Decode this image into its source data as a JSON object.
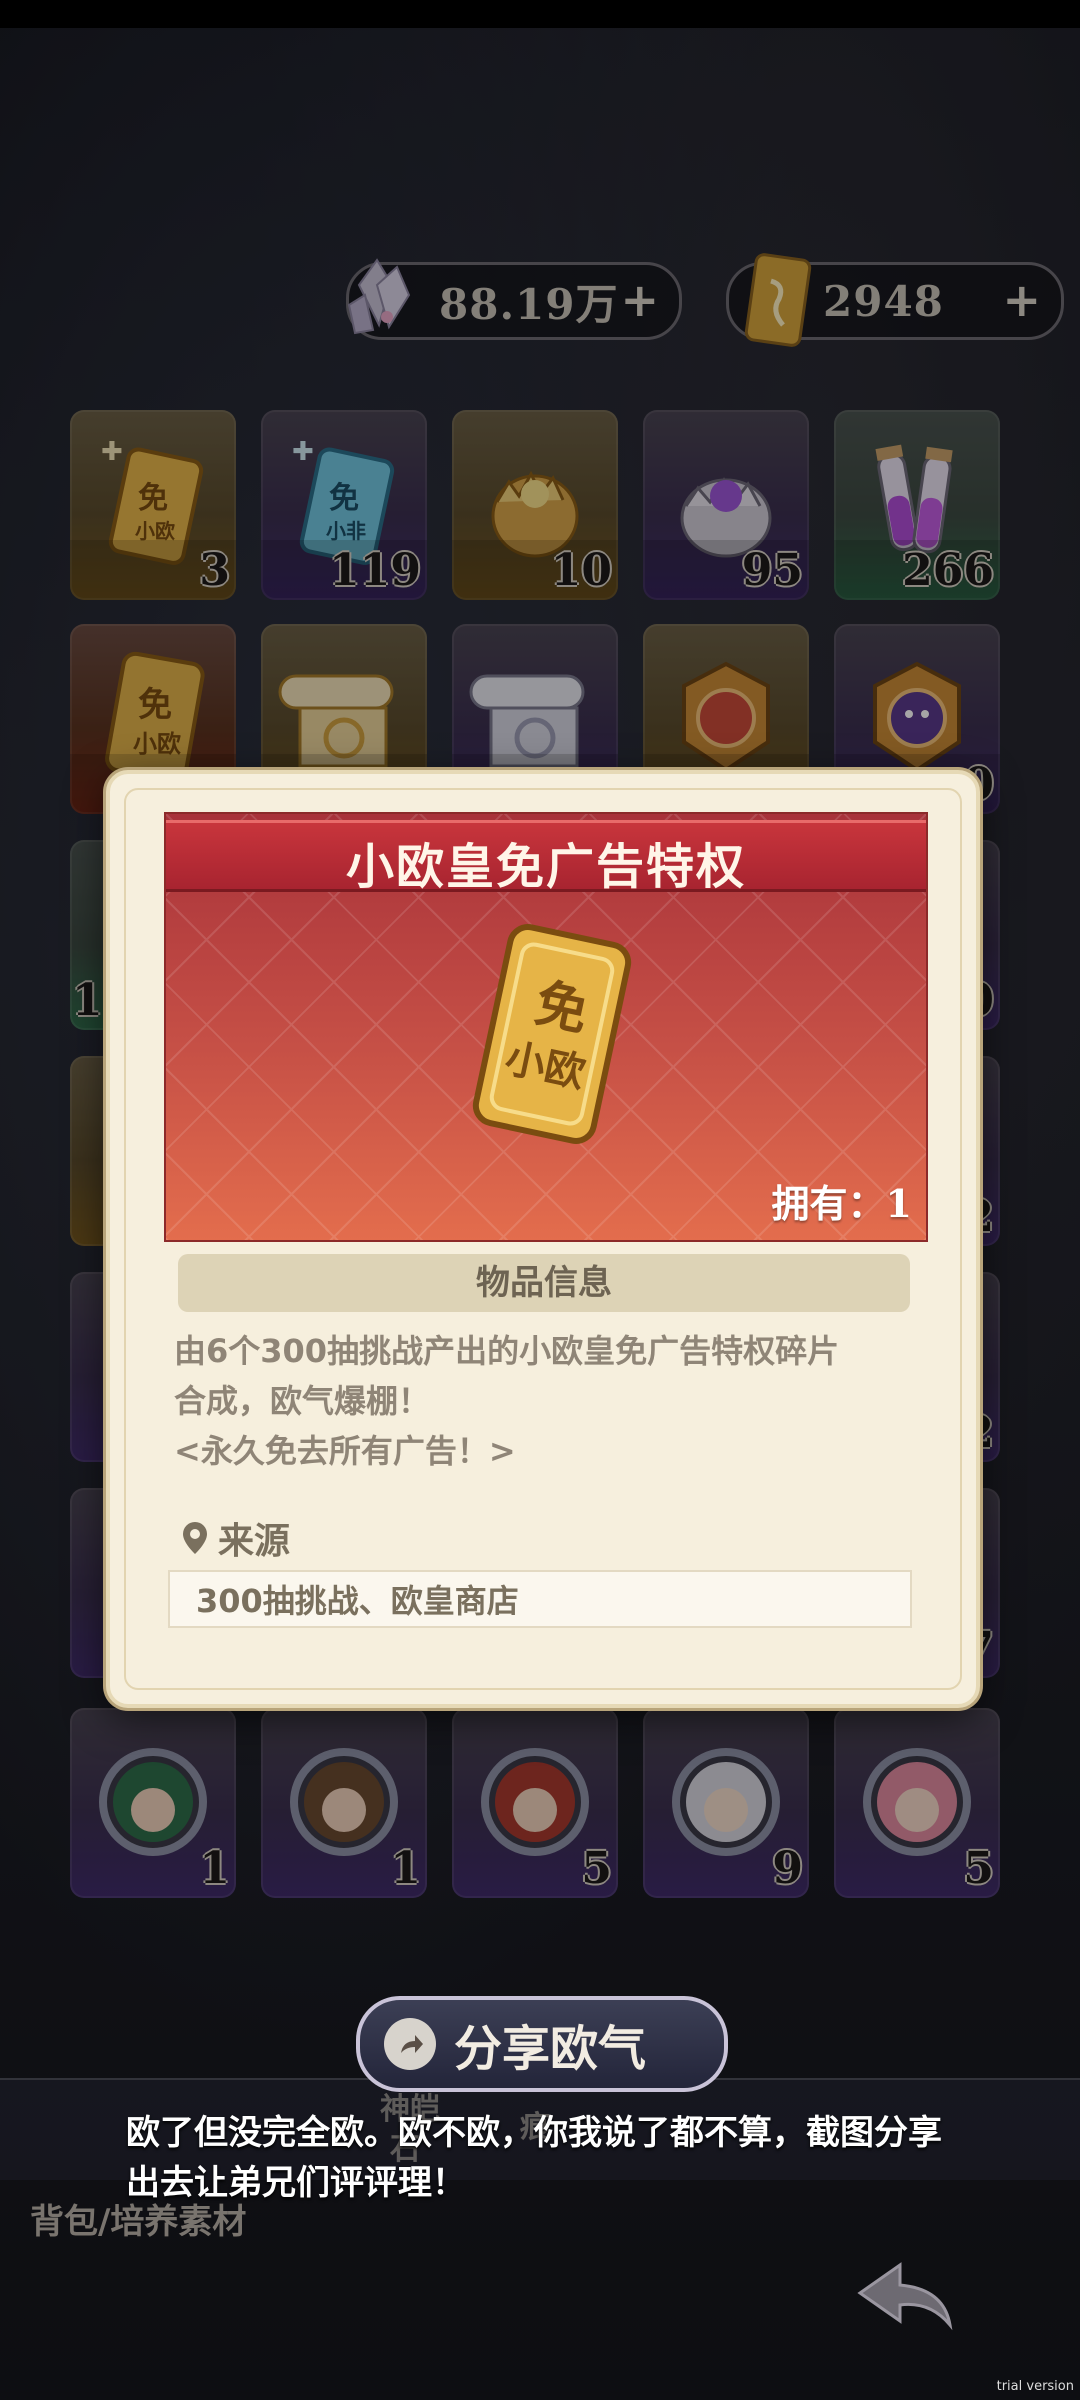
{
  "currency": {
    "crystal": {
      "value": "88.19万",
      "plus": "+",
      "icon": "crystal-icon"
    },
    "ticket": {
      "value": "2948",
      "plus": "+",
      "icon": "ticket-icon"
    }
  },
  "grid": [
    {
      "icon": "gold-ticket-shard-icon",
      "count": "3",
      "style": "gold"
    },
    {
      "icon": "blue-ticket-shard-icon",
      "count": "119",
      "style": "purple"
    },
    {
      "icon": "golden-egg-icon",
      "count": "10",
      "style": "gold"
    },
    {
      "icon": "purple-egg-icon",
      "count": "95",
      "style": "purple"
    },
    {
      "icon": "potion-vials-icon",
      "count": "266",
      "style": "green"
    },
    {
      "icon": "gold-ticket-icon",
      "count": "",
      "style": "red"
    },
    {
      "icon": "golden-scroll-icon",
      "count": "",
      "style": "gold"
    },
    {
      "icon": "silver-scroll-icon",
      "count": "",
      "style": "purple"
    },
    {
      "icon": "red-emblem-icon",
      "count": "",
      "style": "gold"
    },
    {
      "icon": "purple-emblem-icon",
      "count": "0",
      "style": "purple"
    }
  ],
  "side_counts_left": [
    "1"
  ],
  "side_counts_right": [
    "0",
    "2",
    "2",
    "7"
  ],
  "portraits": [
    {
      "icon": "portrait-green-hair-icon",
      "count": "1"
    },
    {
      "icon": "portrait-brown-hair-icon",
      "count": "1"
    },
    {
      "icon": "portrait-red-hair-icon",
      "count": "5"
    },
    {
      "icon": "portrait-white-hair-icon",
      "count": "9"
    },
    {
      "icon": "portrait-pink-hair-icon",
      "count": "5"
    }
  ],
  "modal": {
    "title": "小欧皇免广告特权",
    "owned_label": "拥有：",
    "owned_value": "1",
    "info_header": "物品信息",
    "description_line1": "由6个300抽挑战产出的小欧皇免广告特权碎片",
    "description_line2": "合成，欧气爆棚！",
    "description_line3": "<永久免去所有广告！>",
    "source_label": "来源",
    "source_value": "300抽挑战、欧皇商店",
    "ticket_text_top": "免",
    "ticket_text_bottom": "小欧"
  },
  "share_button": {
    "label": "分享欧气",
    "icon": "share-arrow-icon"
  },
  "caption": "欧了但没完全欧。欧不欧，你我说了都不算，截图分享出去让弟兄们评评理！",
  "tab_fragments": {
    "tab1_top": "神皑",
    "tab1_bottom": "石",
    "tab2": "痕"
  },
  "breadcrumb": "背包/培养素材",
  "back_icon": "back-arrow-icon",
  "watermark": "trial version"
}
